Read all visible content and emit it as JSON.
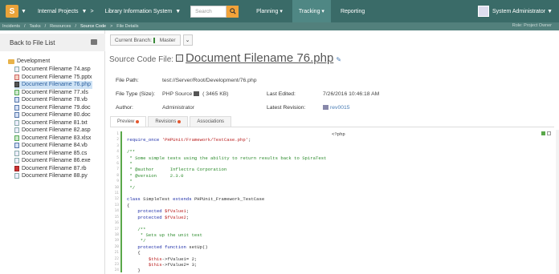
{
  "nav": {
    "project": "Internal Projects",
    "project_sub_caret": ">",
    "product": "Library Information System",
    "search_placeholder": "Search",
    "menu_planning": "Planning",
    "menu_tracking": "Tracking",
    "menu_reporting": "Reporting",
    "user": "System Administrator"
  },
  "breadcrumb": {
    "items": [
      "Incidents",
      "Tasks",
      "Resources",
      "Source Code",
      "File Details"
    ],
    "role": "Role: Project Owner"
  },
  "sidebar": {
    "back_label": "Back to File List",
    "root_folder": "Development",
    "files": [
      "Document Filename 74.asp",
      "Document Filename 75.pptx",
      "Document Filename 76.php",
      "Document Filename 77.xls",
      "Document Filename 78.vb",
      "Document Filename 79.doc",
      "Document Filename 80.doc",
      "Document Filename 81.txt",
      "Document Filename 82.asp",
      "Document Filename 83.xlsx",
      "Document Filename 84.vb",
      "Document Filename 85.cs",
      "Document Filename 86.exe",
      "Document Filename 87.rb",
      "Document Filename 88.py"
    ]
  },
  "branch": {
    "label": "Current Branch:",
    "value": "Master"
  },
  "file": {
    "title_label": "Source Code File:",
    "name": "Document Filename 76.php",
    "path_label": "File Path:",
    "path": "test://Server/Root/Development/76.php",
    "type_label": "File Type (Size):",
    "type": "PHP Source",
    "size": "( 3465 KB)",
    "edited_label": "Last Edited:",
    "edited": "7/26/2016 10:46:18 AM",
    "author_label": "Author:",
    "author": "Administrator",
    "revision_label": "Latest Revision:",
    "revision": "rev0015"
  },
  "tabs": {
    "preview": "Preview",
    "revisions": "Revisions",
    "associations": "Associations"
  },
  "code": {
    "line_numbers": [
      "1",
      "2",
      "3",
      "4",
      "5",
      "6",
      "7",
      "8",
      "9",
      "10",
      "11",
      "12",
      "13",
      "14",
      "15",
      "16",
      "17",
      "18",
      "19",
      "20",
      "21",
      "22",
      "23",
      "24",
      "25"
    ],
    "l1": "<?php",
    "l2a": "require_once",
    "l2b": "'PHPUnit/Framework/TestCase.php'",
    "l2c": ";",
    "l4": "/**",
    "l5": " * Some simple tests using the ability to return results back to SpiraTest",
    "l6": " *",
    "l7": " * @author      Inflectra Corporation",
    "l8": " * @version     2.3.0",
    "l9": " *",
    "l10": " */",
    "l12a": "class",
    "l12b": " SimpleTest ",
    "l12c": "extends",
    "l12d": " PHPUnit_Framework_TestCase",
    "l13": "{",
    "l14a": "    protected",
    "l14b": " $fValue1",
    "l14c": ";",
    "l15a": "    protected",
    "l15b": " $fValue2",
    "l15c": ";",
    "l17": "    /**",
    "l18": "     * Sets up the unit test",
    "l19": "     */",
    "l20a": "    protected function",
    "l20b": " setUp()",
    "l21": "    {",
    "l22a": "        $this",
    "l22b": "->fValue1= 2;",
    "l23a": "        $this",
    "l23b": "->fValue2= 3;",
    "l24": "    }"
  },
  "colors": {
    "nav_bg": "#3a6b68",
    "accent": "#f2a33a",
    "selected_row": "#cfe3f5"
  }
}
